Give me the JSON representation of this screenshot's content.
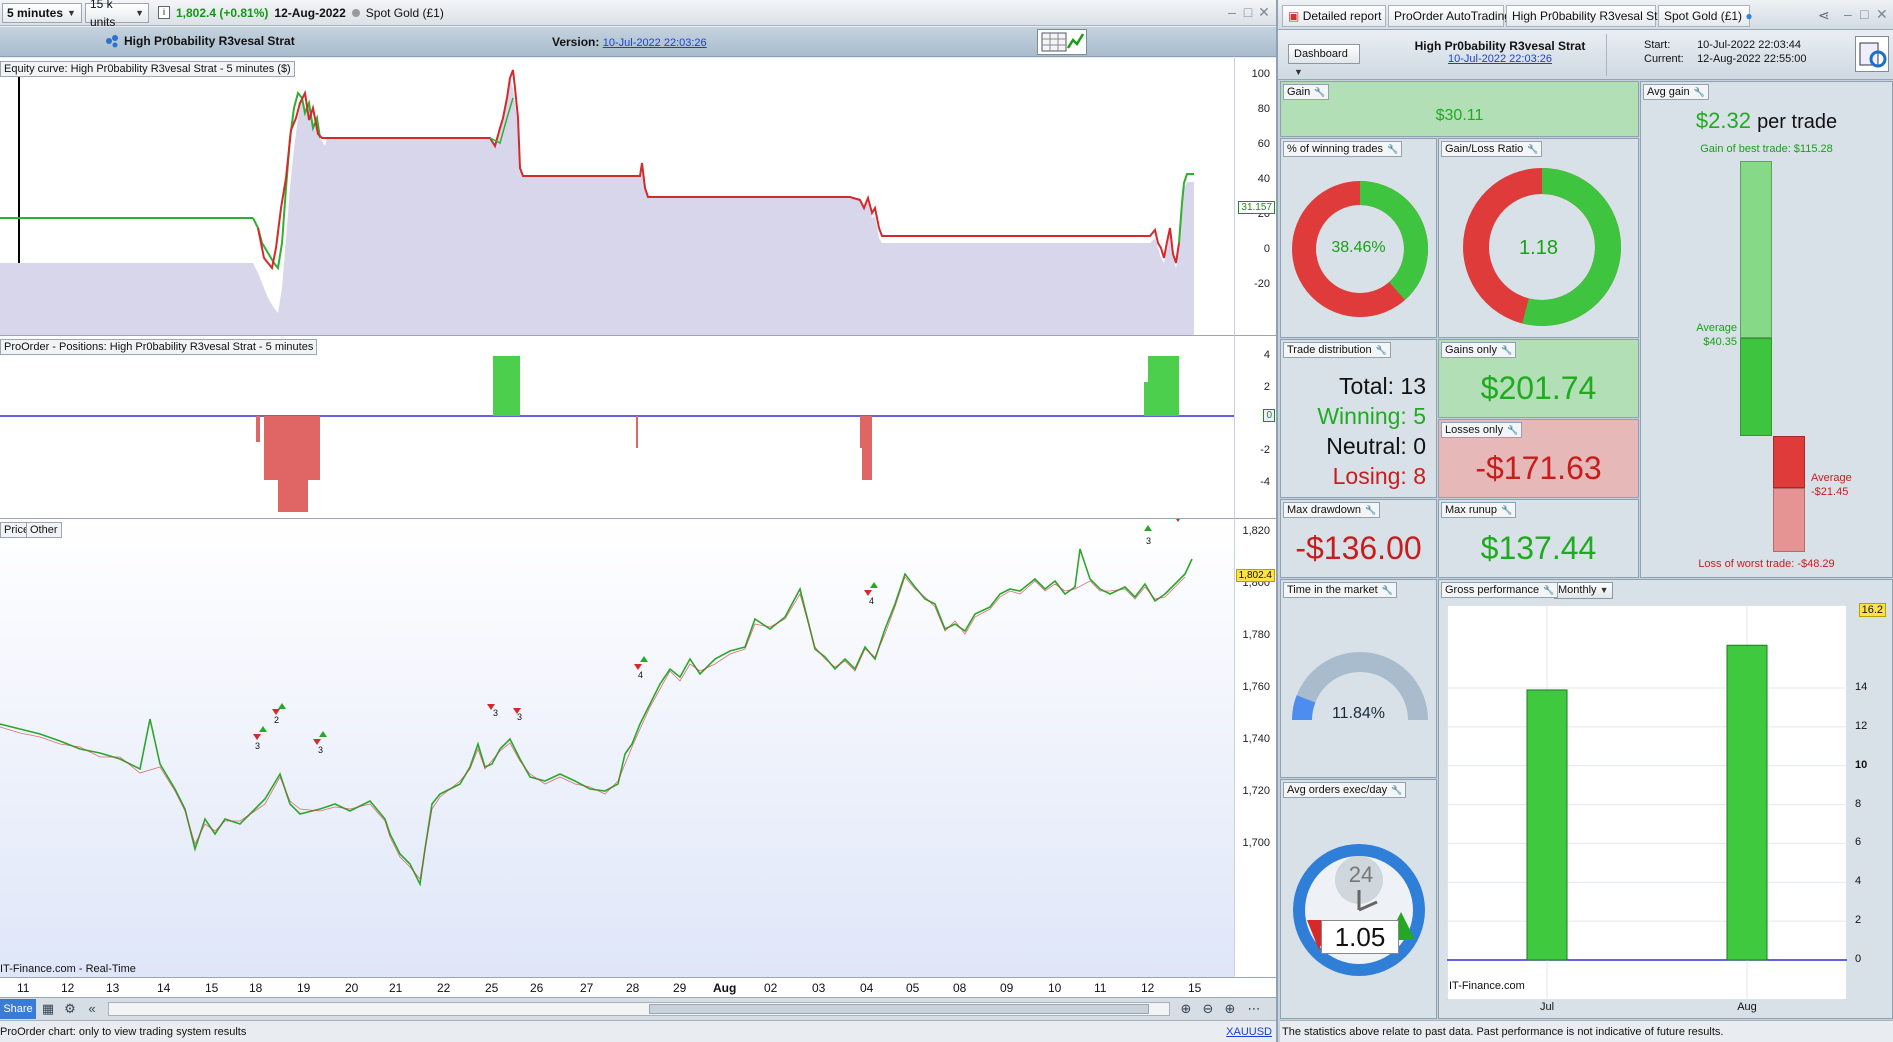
{
  "toolbar": {
    "timeframe": "5 minutes",
    "units": "15 k units",
    "info_glyph": "i",
    "price_change": "1,802.4 (+0.81%)",
    "date": "12-Aug-2022",
    "instrument": "Spot Gold (£1)"
  },
  "titlebar": {
    "strategy_name": "High Pr0bability R3vesal Strat",
    "version_label": "Version:",
    "version_value": "10-Jul-2022 22:03:26"
  },
  "equity": {
    "label": "Equity curve: High Pr0bability R3vesal Strat - 5 minutes ($)",
    "axis_ticks": [
      "100",
      "80",
      "60",
      "40",
      "20",
      "0",
      "-20"
    ],
    "current_tag": "31.157"
  },
  "positions": {
    "label": "ProOrder - Positions: High Pr0bability R3vesal Strat - 5 minutes",
    "axis_ticks": [
      "4",
      "2",
      "-2",
      "-4"
    ],
    "current_tag": "0"
  },
  "price": {
    "tabs": [
      "Price",
      "Other"
    ],
    "axis_ticks": [
      "1,820",
      "1,800",
      "1,780",
      "1,760",
      "1,740",
      "1,720",
      "1,700"
    ],
    "current_tag": "1,802.4",
    "watermark": "IT-Finance.com - Real-Time",
    "trade_markers": [
      {
        "count": "3"
      },
      {
        "count": "2"
      },
      {
        "count": "3"
      },
      {
        "count": "3"
      },
      {
        "count": "3"
      },
      {
        "count": "4"
      },
      {
        "count": "4"
      },
      {
        "count": "3"
      }
    ]
  },
  "date_axis": [
    "11",
    "12",
    "13",
    "14",
    "15",
    "18",
    "19",
    "20",
    "21",
    "22",
    "25",
    "26",
    "27",
    "28",
    "29",
    "Aug",
    "02",
    "03",
    "04",
    "05",
    "08",
    "09",
    "10",
    "11",
    "12",
    "15"
  ],
  "bottom": {
    "share_label": "Share",
    "status_text": "ProOrder chart: only to view trading system results",
    "symbol": "XAUUSD"
  },
  "report": {
    "tabs": [
      "Detailed report",
      "ProOrder AutoTrading",
      "High Pr0bability R3vesal Strat",
      "Spot Gold (£1)"
    ],
    "dashboard_label": "Dashboard",
    "strategy_name": "High Pr0bability R3vesal Strat",
    "strategy_version": "10-Jul-2022 22:03:26",
    "start_label": "Start:",
    "start_value": "10-Jul-2022 22:03:44",
    "current_label": "Current:",
    "current_value": "12-Aug-2022 22:55:00",
    "gain": {
      "label": "Gain",
      "value": "$30.11"
    },
    "avg_gain": {
      "label": "Avg gain",
      "value": "$2.32",
      "unit": "per trade",
      "best_trade": "Gain of best trade: $115.28",
      "avg_win_label": "Average",
      "avg_win_value": "$40.35",
      "avg_loss_label": "Average",
      "avg_loss_value": "-$21.45",
      "worst_trade": "Loss of worst trade: -$48.29"
    },
    "winning_pct": {
      "label": "% of winning trades",
      "value": "38.46%",
      "fraction": 0.3846
    },
    "gain_loss": {
      "label": "Gain/Loss Ratio",
      "value": "1.18",
      "fraction": 0.54
    },
    "distribution": {
      "label": "Trade distribution",
      "total": "Total: 13",
      "winning": "Winning: 5",
      "neutral": "Neutral: 0",
      "losing": "Losing: 8"
    },
    "gains_only": {
      "label": "Gains only",
      "value": "$201.74"
    },
    "losses_only": {
      "label": "Losses only",
      "value": "-$171.63"
    },
    "max_drawdown": {
      "label": "Max drawdown",
      "value": "-$136.00"
    },
    "max_runup": {
      "label": "Max runup",
      "value": "$137.44"
    },
    "time_in_market": {
      "label": "Time in the market",
      "value": "11.84%",
      "fraction": 0.1184
    },
    "avg_orders": {
      "label": "Avg orders exec/day",
      "value": "1.05",
      "clock_label": "24"
    },
    "gross": {
      "label": "Gross performance",
      "period": "Monthly",
      "watermark": "IT-Finance.com",
      "current_tag": "16.2",
      "axis_ticks": [
        "14",
        "12",
        "10",
        "8",
        "6",
        "4",
        "2",
        "0"
      ]
    },
    "disclaimer": "The statistics above relate to past data. Past performance is not indicative of future results."
  },
  "chart_data": {
    "type": "bar",
    "categories": [
      "Jul",
      "Aug"
    ],
    "values": [
      13.9,
      16.2
    ],
    "ylim": [
      0,
      17.5
    ],
    "grid": true,
    "colors": {
      "bar": "#3ec93e"
    }
  },
  "colors": {
    "gain": "#1fab1f",
    "loss": "#c81d1d",
    "accent": "#3a7bd5"
  }
}
